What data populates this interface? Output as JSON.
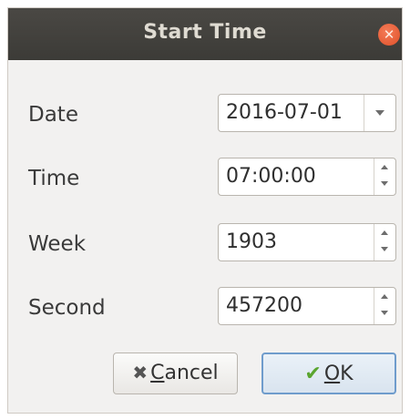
{
  "dialog": {
    "title": "Start Time",
    "close_icon": "close-icon"
  },
  "fields": {
    "date": {
      "label": "Date",
      "value": "2016-07-01"
    },
    "time": {
      "label": "Time",
      "value": "07:00:00"
    },
    "week": {
      "label": "Week",
      "value": "1903"
    },
    "second": {
      "label": "Second",
      "value": "457200"
    }
  },
  "buttons": {
    "cancel": {
      "mnemonic": "C",
      "rest": "ancel",
      "icon": "cancel-x-icon"
    },
    "ok": {
      "mnemonic": "O",
      "rest": "K",
      "icon": "checkmark-icon"
    }
  },
  "colors": {
    "titlebar": "#3c3b37",
    "close_button": "#e95420",
    "ok_border": "#6f9ccc",
    "checkmark": "#5aa52f"
  }
}
